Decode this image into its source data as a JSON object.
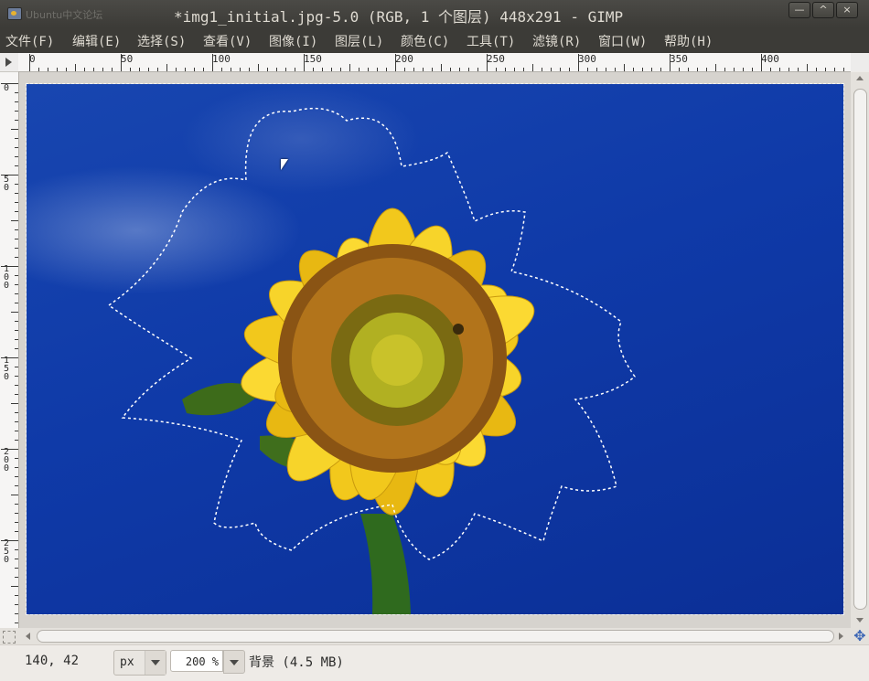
{
  "window": {
    "background_title": "Ubuntu中文论坛",
    "title": "*img1_initial.jpg-5.0 (RGB, 1 个图层) 448x291 - GIMP",
    "buttons": {
      "minimize": "—",
      "maximize": "^",
      "close": "×"
    }
  },
  "menubar": {
    "items": [
      "文件(F)",
      "编辑(E)",
      "选择(S)",
      "查看(V)",
      "图像(I)",
      "图层(L)",
      "颜色(C)",
      "工具(T)",
      "滤镜(R)",
      "窗口(W)",
      "帮助(H)"
    ]
  },
  "rulers": {
    "horizontal_labels": [
      "0",
      "50",
      "100",
      "150",
      "200",
      "250",
      "300",
      "350",
      "400"
    ],
    "vertical_labels": [
      "0",
      "50",
      "100",
      "150",
      "200",
      "250"
    ]
  },
  "statusbar": {
    "coordinates": "140, 42",
    "unit": "px",
    "zoom": "200 %",
    "layer_info": "背景 (4.5 MB)"
  },
  "colors": {
    "titlebar": "#3c3b37",
    "sky": "#0f3aa8",
    "petal": "#f2c81c",
    "center": "#7a4a12"
  },
  "icons": [
    "app-icon",
    "ruler-toggle-icon",
    "navigate-icon",
    "quick-mask-icon"
  ]
}
